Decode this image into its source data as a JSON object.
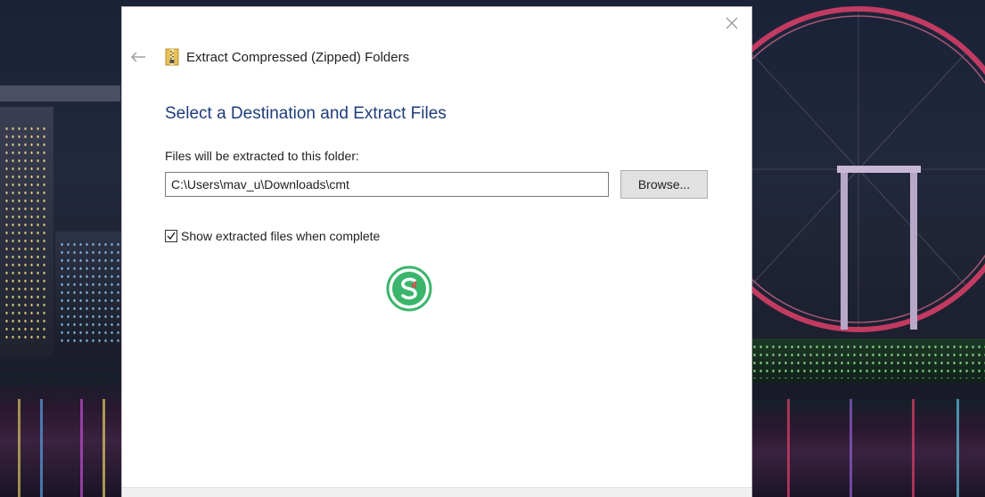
{
  "window": {
    "title": "Extract Compressed (Zipped) Folders",
    "icons": {
      "close": "close-icon",
      "back": "back-arrow-icon",
      "app": "zip-folder-icon"
    }
  },
  "page": {
    "heading": "Select a Destination and Extract Files",
    "destination_label": "Files will be extracted to this folder:",
    "destination_value": "C:\\Users\\mav_u\\Downloads\\cmt",
    "browse_label": "Browse...",
    "show_files_label": "Show extracted files when complete",
    "show_files_checked": true
  },
  "colors": {
    "heading": "#1f3c7b",
    "watermark": "#3bb56b"
  }
}
